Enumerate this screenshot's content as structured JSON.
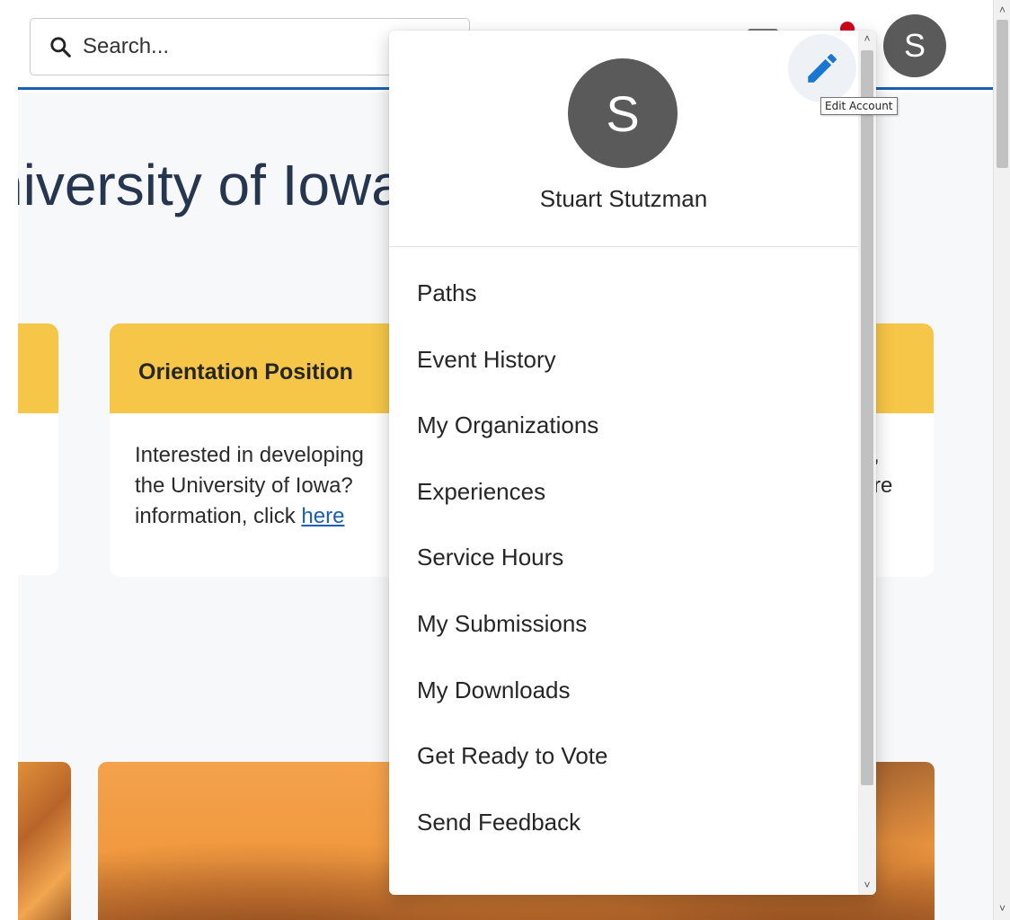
{
  "header": {
    "search_placeholder": "Search...",
    "avatar_initial": "S"
  },
  "content": {
    "page_title": "niversity of Iowa",
    "orientation_card": {
      "title": "Orientation Position",
      "line1": "Interested in developing",
      "line2": "the University of Iowa?",
      "line3_prefix": "information, click ",
      "link_text": "here",
      "right_fragment_1": ",",
      "right_fragment_2": "re"
    }
  },
  "dropdown": {
    "avatar_initial": "S",
    "user_name": "Stuart Stutzman",
    "edit_tooltip": "Edit Account",
    "menu_items": [
      "Paths",
      "Event History",
      "My Organizations",
      "Experiences",
      "Service Hours",
      "My Submissions",
      "My Downloads",
      "Get Ready to Vote",
      "Send Feedback"
    ]
  },
  "colors": {
    "accent_blue": "#1a5fb4",
    "card_yellow": "#f6c648",
    "avatar_gray": "#5a5a5a",
    "edit_icon_blue": "#1976d2",
    "notification_red": "#d0021b"
  }
}
